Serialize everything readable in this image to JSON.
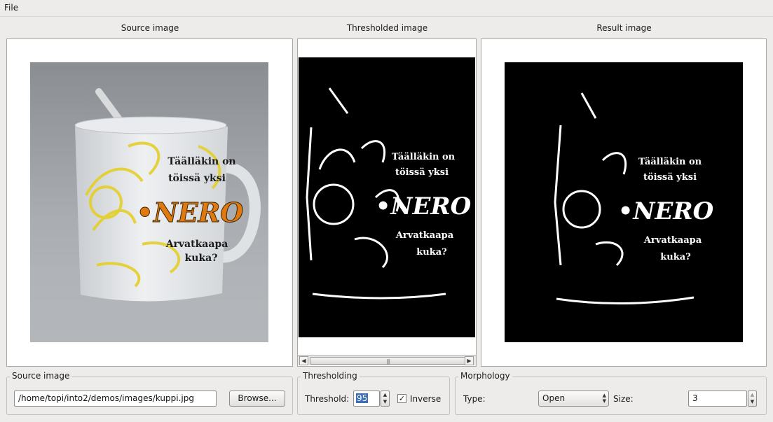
{
  "menubar": {
    "file": "File"
  },
  "panels": {
    "source_title": "Source image",
    "threshold_title": "Thresholded image",
    "result_title": "Result image"
  },
  "mug_text": {
    "line1": "Täälläkin on",
    "line2": "töissä yksi",
    "brand": "•NERO",
    "line3": "Arvatkaapa",
    "line4": "kuka?"
  },
  "source_group": {
    "title": "Source image",
    "path_value": "/home/topi/into2/demos/images/kuppi.jpg",
    "browse_label": "Browse..."
  },
  "thresholding_group": {
    "title": "Thresholding",
    "threshold_label": "Threshold:",
    "threshold_value": "95",
    "inverse_label": "Inverse",
    "inverse_checked": true
  },
  "morphology_group": {
    "title": "Morphology",
    "type_label": "Type:",
    "type_value": "Open",
    "size_label": "Size:",
    "size_value": "3"
  },
  "colors": {
    "window_bg": "#edeceb",
    "selection": "#3d6fb5",
    "mug_accent": "#e07a10",
    "mug_pattern": "#e4cf2a"
  },
  "icons": [
    "spin-up-icon",
    "spin-down-icon",
    "combo-arrows-icon",
    "scroll-left-icon",
    "scroll-right-icon",
    "check-icon"
  ]
}
